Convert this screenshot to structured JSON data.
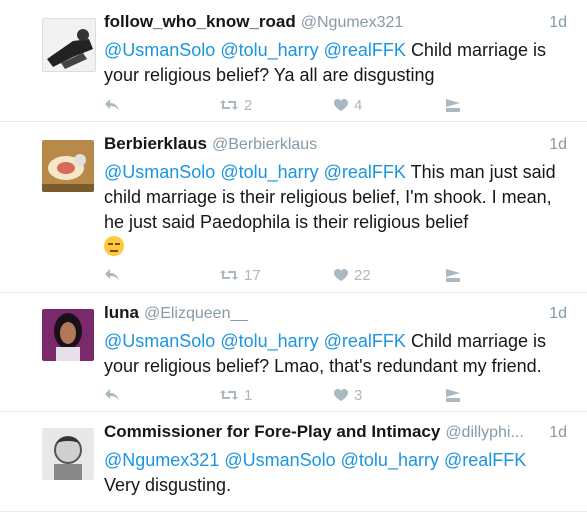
{
  "tweets": [
    {
      "name": "follow_who_know_road",
      "handle": "@Ngumex321",
      "time": "1d",
      "mentions": "@UsmanSolo @tolu_harry @realFFK",
      "text": "Child marriage is your religious belief?  Ya all are disgusting",
      "retweets": "2",
      "likes": "4",
      "avatar_icon": "user-photo"
    },
    {
      "name": "Berbierklaus",
      "handle": "@Berbierklaus",
      "time": "1d",
      "mentions": "@UsmanSolo @tolu_harry @realFFK",
      "text": "This man just said child marriage is their religious belief, I'm  shook. I mean, he just said Paedophila is their religious belief",
      "retweets": "17",
      "likes": "22",
      "avatar_icon": "user-photo"
    },
    {
      "name": "luna",
      "handle": "@Elizqueen__",
      "time": "1d",
      "mentions": "@UsmanSolo @tolu_harry @realFFK",
      "text": "Child marriage is your religious belief? Lmao, that's redundant my friend.",
      "retweets": "1",
      "likes": "3",
      "avatar_icon": "user-photo"
    },
    {
      "name": "Commissioner for Fore-Play and Intimacy",
      "handle": "@dillyphi...",
      "time": "1d",
      "mentions": "@Ngumex321 @UsmanSolo @tolu_harry @realFFK",
      "text": "Very disgusting.",
      "avatar_icon": "user-photo"
    }
  ],
  "colors": {
    "mention": "#1b95e0",
    "muted": "#8899a6",
    "icon": "#aab8c2"
  },
  "icons": [
    "reply-icon",
    "retweet-icon",
    "like-icon",
    "message-icon",
    "weary-face-emoji"
  ]
}
